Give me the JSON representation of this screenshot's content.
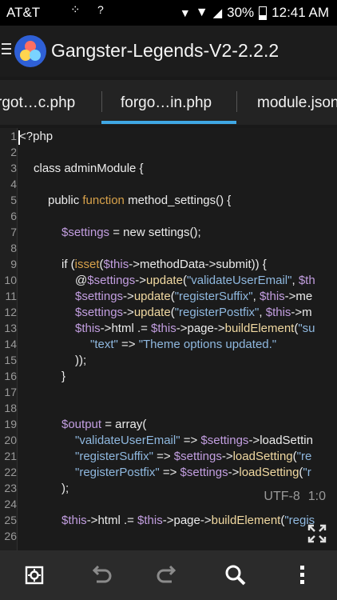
{
  "status": {
    "carrier": "AT&T",
    "battery": "30%",
    "time": "12:41 AM",
    "signal_glyph": "?"
  },
  "app": {
    "title": "Gangster-Legends-V2-2.2.2",
    "logo_icon": "app-logo-icon",
    "menu_icon": "hamburger-icon"
  },
  "tabs": [
    {
      "label": "rgot…c.php"
    },
    {
      "label": "forgo…in.php",
      "active": true
    },
    {
      "label": "module.json"
    }
  ],
  "editor": {
    "encoding": "UTF-8",
    "position": "1:0",
    "line_numbers": [
      "1",
      "2",
      "3",
      "4",
      "5",
      "6",
      "7",
      "8",
      "9",
      "10",
      "11",
      "12",
      "13",
      "14",
      "15",
      "16",
      "17",
      "18",
      "19",
      "20",
      "21",
      "22",
      "23",
      "24",
      "25",
      "26"
    ],
    "lines": [
      "<?php",
      "",
      "class adminModule {",
      "",
      "public function method_settings() {",
      "",
      "$settings = new settings();",
      "",
      "if (isset($this->methodData->submit)) {",
      "@$settings->update(\"validateUserEmail\", $th",
      "$settings->update(\"registerSuffix\", $this->me",
      "$settings->update(\"registerPostfix\", $this->m",
      "$this->html .= $this->page->buildElement(\"su",
      "\"text\" => \"Theme options updated.\"",
      "));",
      "}",
      "",
      "",
      "$output = array(",
      "\"validateUserEmail\" => $settings->loadSettin",
      "\"registerSuffix\" => $settings->loadSetting(\"re",
      "\"registerPostfix\" => $settings->loadSetting(\"r",
      ");",
      "",
      "$this->html .= $this->page->buildElement(\"regis",
      ""
    ]
  },
  "toolbar": {
    "settings_icon": "settings-icon",
    "undo_icon": "undo-icon",
    "redo_icon": "redo-icon",
    "search_icon": "search-icon",
    "more_icon": "more-vert-icon"
  },
  "colors": {
    "accent": "#40a8e4",
    "keyword": "#d8a24b",
    "variable": "#c29ee0",
    "string": "#8fb8df"
  }
}
